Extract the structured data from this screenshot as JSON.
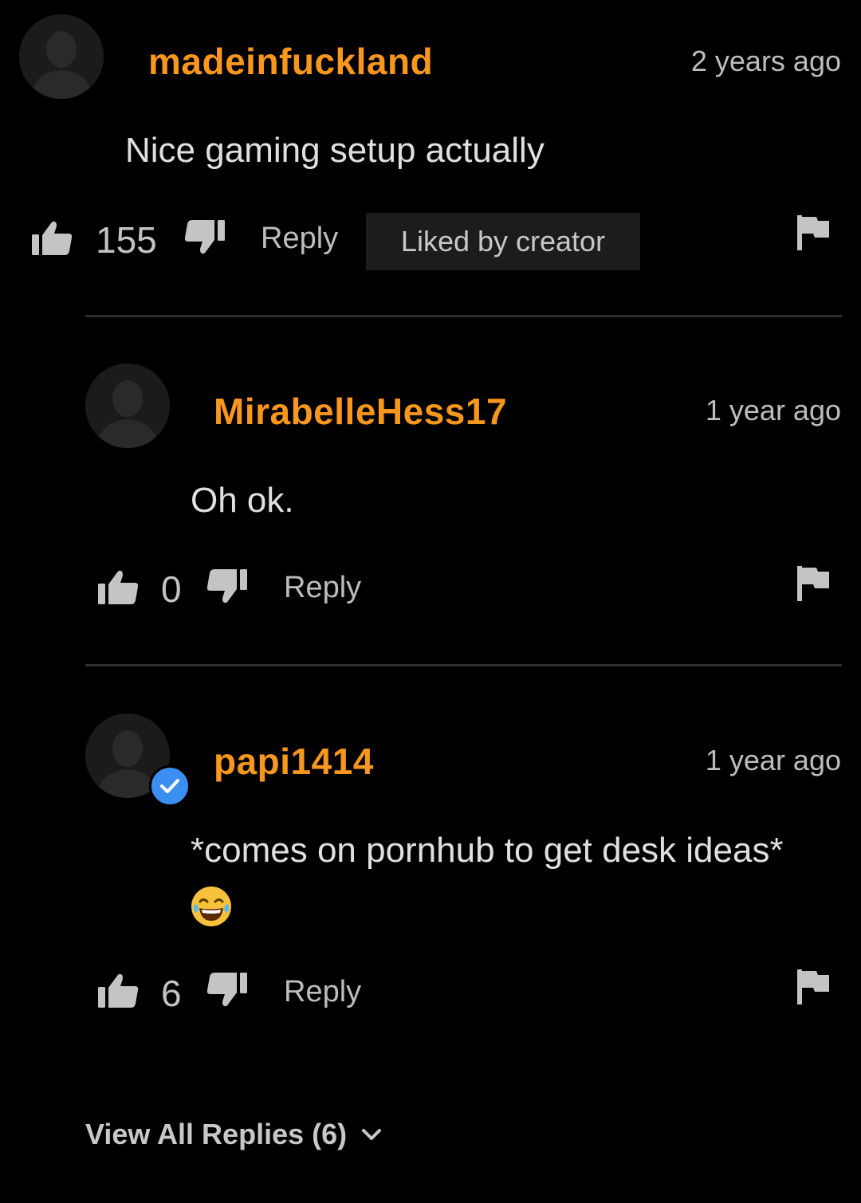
{
  "comments": [
    {
      "username": "madeinfuckland",
      "timestamp": "2 years ago",
      "text": "Nice gaming setup actually",
      "likes": "155",
      "reply_label": "Reply",
      "badge": "Liked by creator"
    },
    {
      "username": "MirabelleHess17",
      "timestamp": "1 year ago",
      "text": "Oh ok.",
      "likes": "0",
      "reply_label": "Reply"
    },
    {
      "username": "papi1414",
      "timestamp": "1 year ago",
      "text": "*comes on pornhub to get desk ideas*",
      "emoji": "face-with-tears-of-joy",
      "likes": "6",
      "reply_label": "Reply",
      "verified": true
    }
  ],
  "view_all_replies": "View All Replies (6)",
  "colors": {
    "username": "#f7971d",
    "background": "#000000",
    "verified": "#3b8ff0"
  },
  "icons": [
    "avatar-silhouette-icon",
    "thumbs-up-icon",
    "thumbs-down-icon",
    "flag-icon",
    "verified-check-icon",
    "chevron-down-icon"
  ]
}
